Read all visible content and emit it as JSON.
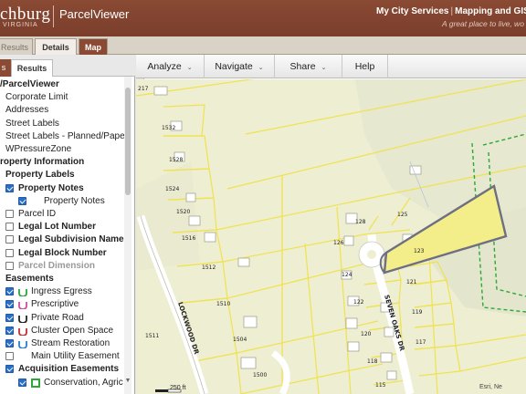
{
  "header": {
    "city": "chburg",
    "city_sub": "VIRGINIA",
    "app_name": "ParcelViewer",
    "links": [
      "My City Services",
      "Mapping and GIS",
      "2"
    ],
    "tagline": "A great place to live, wo"
  },
  "main_tabs": [
    "Results",
    "Details",
    "Map"
  ],
  "panel_tabs": [
    "s",
    "Results"
  ],
  "layers": [
    {
      "label": "/ParcelViewer",
      "bold": true,
      "indent": 0,
      "checkbox": null
    },
    {
      "label": "Corporate Limit",
      "indent": 6,
      "checkbox": null
    },
    {
      "label": "Addresses",
      "indent": 6,
      "checkbox": null
    },
    {
      "label": "Street Labels",
      "indent": 6,
      "checkbox": null
    },
    {
      "label": "Street Labels - Planned/Paper",
      "indent": 6,
      "checkbox": null
    },
    {
      "label": "WPressureZone",
      "indent": 6,
      "checkbox": null
    },
    {
      "label": "roperty Information",
      "bold": true,
      "indent": 0,
      "checkbox": null
    },
    {
      "label": "Property Labels",
      "bold": true,
      "indent": 6,
      "checkbox": null
    },
    {
      "label": "Property Notes",
      "bold": true,
      "indent": 6,
      "checkbox": "on"
    },
    {
      "label": "Property Notes",
      "indent": 20,
      "checkbox": "on",
      "sub": true
    },
    {
      "label": "Parcel ID",
      "indent": 6,
      "checkbox": "off"
    },
    {
      "label": "Legal Lot Number",
      "bold": true,
      "indent": 6,
      "checkbox": "off"
    },
    {
      "label": "Legal Subdivision Name",
      "bold": true,
      "indent": 6,
      "checkbox": "off"
    },
    {
      "label": "Legal Block Number",
      "bold": true,
      "indent": 6,
      "checkbox": "off"
    },
    {
      "label": "Parcel Dimension",
      "bold": true,
      "indent": 6,
      "checkbox": "off",
      "disabled": true
    },
    {
      "label": "Easements",
      "bold": true,
      "indent": 6,
      "checkbox": null
    },
    {
      "label": "Ingress Egress",
      "indent": 6,
      "checkbox": "on",
      "symbol": "#2aa838"
    },
    {
      "label": "Prescriptive",
      "indent": 6,
      "checkbox": "on",
      "symbol": "#d64a9a"
    },
    {
      "label": "Private Road",
      "indent": 6,
      "checkbox": "on",
      "symbol": "#222222"
    },
    {
      "label": "Cluster Open Space",
      "indent": 6,
      "checkbox": "on",
      "symbol": "#c23030"
    },
    {
      "label": "Stream Restoration",
      "indent": 6,
      "checkbox": "on",
      "symbol": "#2a7fd4"
    },
    {
      "label": "Main Utility Easement",
      "indent": 6,
      "checkbox": "off",
      "symbol": null
    },
    {
      "label": "Acquisition Easements",
      "bold": true,
      "indent": 6,
      "checkbox": "on"
    },
    {
      "label": "Conservation, Agric",
      "indent": 20,
      "checkbox": "on",
      "symbol": "#2aa838",
      "square": true
    }
  ],
  "toolbar": [
    "Analyze",
    "Navigate",
    "Share",
    "Help"
  ],
  "map": {
    "parcel_labels": [
      "217",
      "1532",
      "1528",
      "1524",
      "1520",
      "1516",
      "1512",
      "1510",
      "1504",
      "1500",
      "1511",
      "128",
      "125",
      "126",
      "123",
      "124",
      "121",
      "122",
      "119",
      "120",
      "117",
      "118",
      "115"
    ],
    "streets": [
      "LOCKWOOD DR",
      "SEVEN OAKS DR"
    ],
    "selected_color": "#f4ee8a",
    "scale_label": "250 ft",
    "attribution": "Esri, Ne"
  }
}
